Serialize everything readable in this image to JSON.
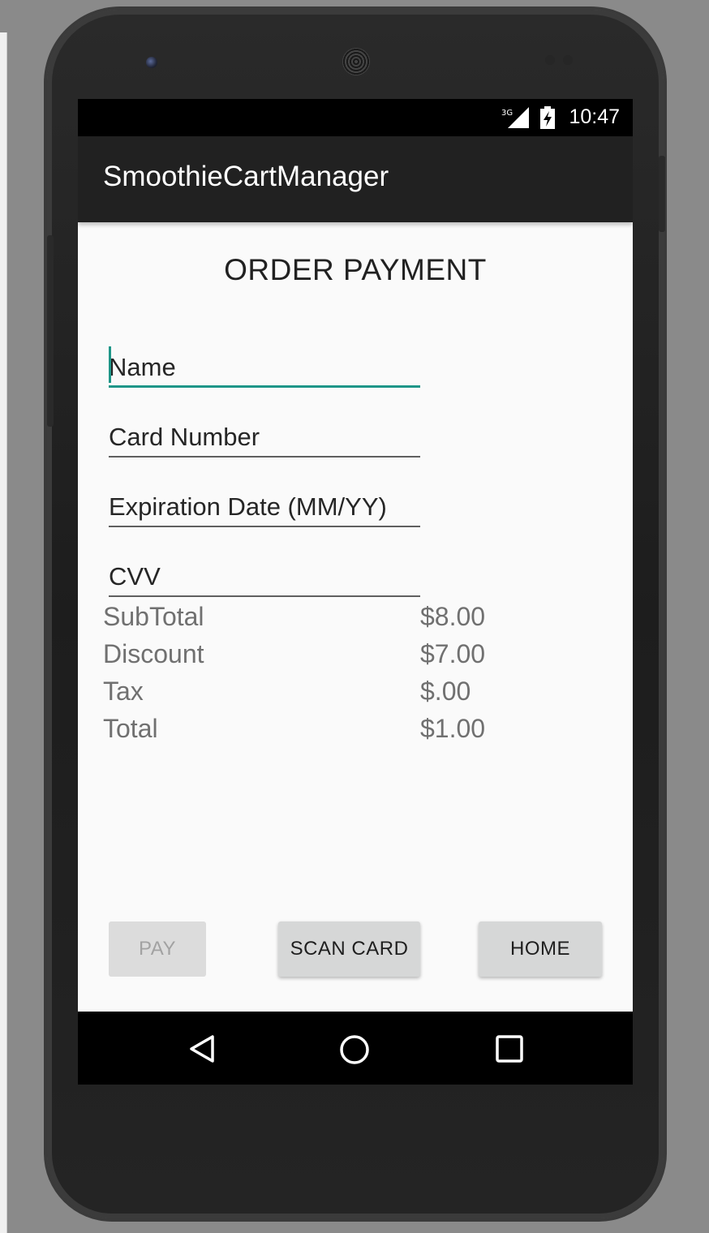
{
  "status_bar": {
    "network": "3G",
    "time": "10:47"
  },
  "app": {
    "title": "SmoothieCartManager"
  },
  "page": {
    "title": "ORDER PAYMENT"
  },
  "form": {
    "name": {
      "value": "",
      "placeholder": "Name"
    },
    "card_number": {
      "value": "",
      "placeholder": "Card Number"
    },
    "expiration": {
      "value": "",
      "placeholder": "Expiration Date (MM/YY)"
    },
    "cvv": {
      "value": "",
      "placeholder": "CVV"
    }
  },
  "summary": [
    {
      "label": "SubTotal",
      "value": "$8.00"
    },
    {
      "label": "Discount",
      "value": "$7.00"
    },
    {
      "label": "Tax",
      "value": "$.00"
    },
    {
      "label": "Total",
      "value": "$1.00"
    }
  ],
  "buttons": {
    "pay": "PAY",
    "scan_card": "SCAN CARD",
    "home": "HOME"
  },
  "nav": {
    "back_icon": "back-triangle-icon",
    "home_icon": "home-circle-icon",
    "recents_icon": "recents-square-icon"
  },
  "colors": {
    "accent": "#1e9688",
    "action_bar": "#212121",
    "screen_bg": "#fafafa",
    "button_bg": "#d6d7d7"
  }
}
